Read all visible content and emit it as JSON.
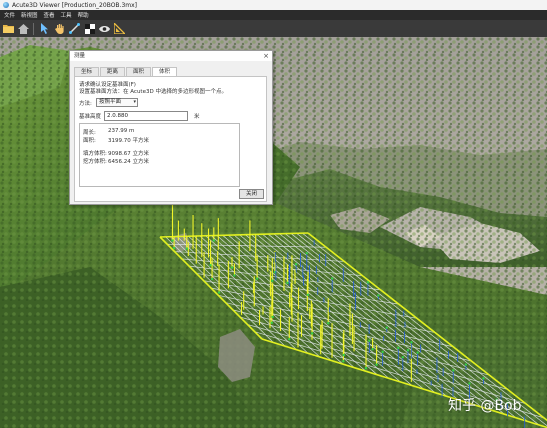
{
  "window": {
    "title": "Acute3D Viewer [Production_20BOB.3mx]"
  },
  "menu": {
    "items": [
      "文件",
      "新視图",
      "查看",
      "工具",
      "帮助"
    ]
  },
  "toolbar": {
    "buttons": [
      {
        "icon": "open-folder-icon"
      },
      {
        "icon": "home-view-icon"
      },
      {
        "icon": "pointer-icon"
      },
      {
        "icon": "hand-pan-icon"
      },
      {
        "icon": "measure-distance-icon"
      },
      {
        "icon": "grid-icon"
      },
      {
        "icon": "eye-icon"
      },
      {
        "icon": "ruler-triangle-icon"
      }
    ]
  },
  "dialog": {
    "title": "测量",
    "close": "×",
    "tabs": [
      "坐标",
      "距离",
      "面积",
      "体积"
    ],
    "active_tab": "体积",
    "hint_line1": "请求确认设定基准面(F)",
    "hint_line2": "设置基准面方法：在 Acute3D 中选择的多边形视图一个点。",
    "method_label": "方法:",
    "method_value": "按照平面",
    "elevation_label": "基准高度",
    "elevation_value": "2.0.880",
    "elevation_unit": "米",
    "results": [
      {
        "label": "周长:",
        "value": "237.99 m"
      },
      {
        "label": "面积:",
        "value": "3199.70 平方米"
      },
      {
        "label": "填方体积:",
        "value": "9098.67 立方米"
      },
      {
        "label": "挖方体积:",
        "value": "6456.24 立方米"
      }
    ],
    "ok_label": "关闭"
  },
  "watermark": "知乎 @Bob",
  "colors": {
    "grid_line": "#e8ecf2",
    "boundary": "#e2f020",
    "fill_pin": "#f1f52a",
    "cut_pin": "#1f5bd8",
    "marker": "#38d24a"
  }
}
